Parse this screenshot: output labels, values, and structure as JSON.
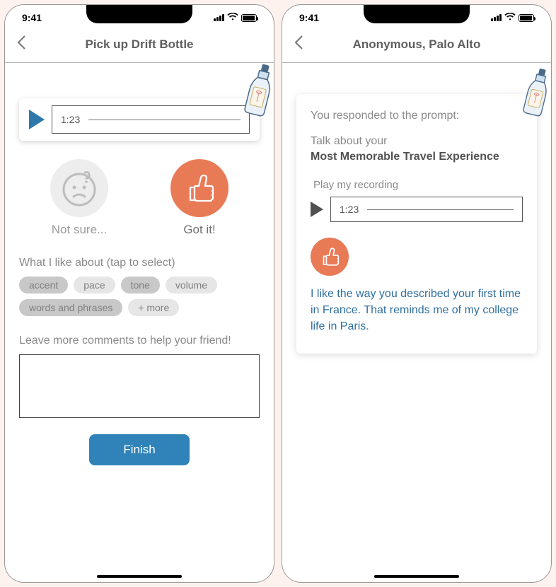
{
  "status": {
    "time": "9:41"
  },
  "left": {
    "header": {
      "title": "Pick up Drift Bottle"
    },
    "player": {
      "time": "1:23"
    },
    "ratings": {
      "notSure": "Not sure...",
      "gotIt": "Got it!"
    },
    "likeSection": {
      "label": "What I like about (tap to select)",
      "chips": [
        "accent",
        "pace",
        "tone",
        "volume",
        "words and phrases",
        "+ more"
      ]
    },
    "commentLabel": "Leave more comments to help your friend!",
    "finish": "Finish"
  },
  "right": {
    "header": {
      "title": "Anonymous, Palo Alto"
    },
    "promptIntro": "You responded to the prompt:",
    "promptLead": "Talk about your",
    "promptTopic": "Most Memorable Travel Experience",
    "playLabel": "Play my recording",
    "player": {
      "time": "1:23"
    },
    "feedback": "I like the way you described your first time in France. That reminds me of my college life in Paris."
  }
}
